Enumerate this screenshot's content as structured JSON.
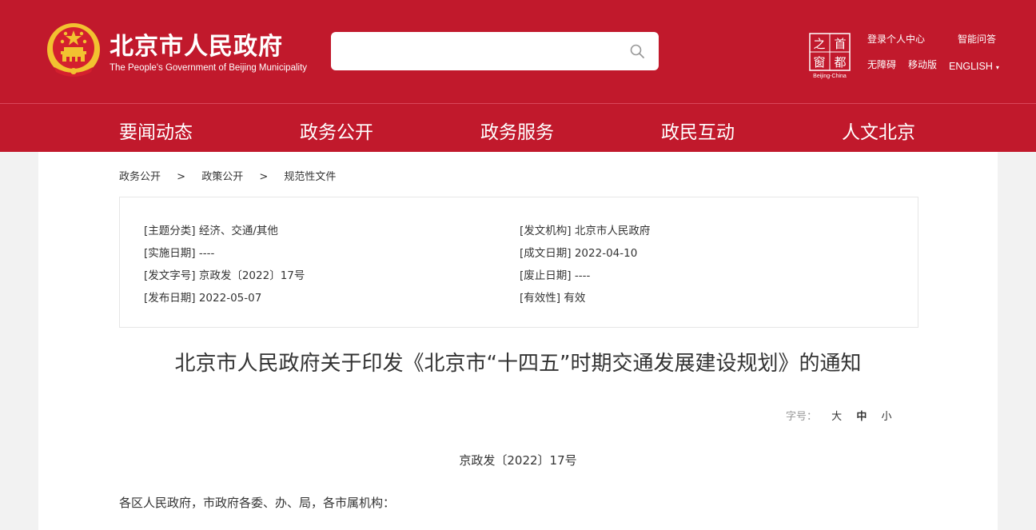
{
  "header": {
    "title": "北京市人民政府",
    "subtitle": "The People's Government of Beijing Municipality",
    "search": {
      "placeholder": ""
    },
    "capital_logo": {
      "chars": [
        "之",
        "首",
        "窗",
        "都"
      ],
      "caption": "Beijing-China"
    },
    "links": {
      "login": "登录个人中心",
      "smart_qa": "智能问答",
      "accessible": "无障碍",
      "mobile": "移动版",
      "english": "ENGLISH",
      "english_arrow": "▾"
    }
  },
  "nav": [
    "要闻动态",
    "政务公开",
    "政务服务",
    "政民互动",
    "人文北京"
  ],
  "breadcrumb": [
    "政务公开",
    "政策公开",
    "规范性文件"
  ],
  "breadcrumb_sep": ">",
  "meta": [
    {
      "key": "[主题分类]",
      "value": "经济、交通/其他"
    },
    {
      "key": "[发文机构]",
      "value": "北京市人民政府"
    },
    {
      "key": "[实施日期]",
      "value": "----"
    },
    {
      "key": "[成文日期]",
      "value": "2022-04-10"
    },
    {
      "key": "[发文字号]",
      "value": "京政发〔2022〕17号"
    },
    {
      "key": "[废止日期]",
      "value": "----"
    },
    {
      "key": "[发布日期]",
      "value": "2022-05-07"
    },
    {
      "key": "[有效性]",
      "value": "有效"
    }
  ],
  "document": {
    "title": "北京市人民政府关于印发《北京市“十四五”时期交通发展建设规划》的通知",
    "number": "京政发〔2022〕17号",
    "recipients": "各区人民政府，市政府各委、办、局，各市属机构："
  },
  "font_size": {
    "label": "字号：",
    "options": [
      "大",
      "中",
      "小"
    ],
    "selected": "中"
  },
  "colors": {
    "brand_red": "#c1192c",
    "gold": "#f2c230"
  }
}
